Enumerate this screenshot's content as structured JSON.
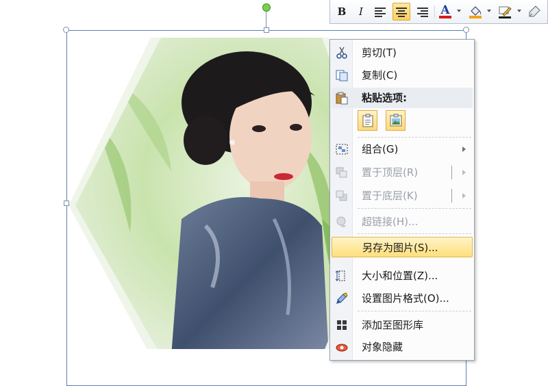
{
  "image": {
    "description_icon": "hexagon-portrait-photo",
    "colors": {
      "selection": "#5b7fb4",
      "rotate_handle": "#7bd04a",
      "bg_green": "#cfe7b3"
    }
  },
  "mini_toolbar": {
    "bold": "B",
    "italic": "I",
    "font_color": "A"
  },
  "context_menu": {
    "items": [
      {
        "label": "剪切(T)",
        "icon": "scissors-icon"
      },
      {
        "label": "复制(C)",
        "icon": "copy-icon"
      },
      {
        "label": "粘贴选项:",
        "icon": "paste-icon"
      },
      {
        "label": "组合(G)",
        "icon": "group-icon"
      },
      {
        "label": "置于顶层(R)",
        "icon": "bring-front-icon"
      },
      {
        "label": "置于底层(K)",
        "icon": "send-back-icon"
      },
      {
        "label": "超链接(H)...",
        "icon": "hyperlink-icon"
      },
      {
        "label": "另存为图片(S)...",
        "icon": "save-as-picture-icon"
      },
      {
        "label": "大小和位置(Z)...",
        "icon": "size-position-icon"
      },
      {
        "label": "设置图片格式(O)...",
        "icon": "format-picture-icon"
      },
      {
        "label": "添加至图形库",
        "icon": "add-to-gallery-icon"
      },
      {
        "label": "对象隐藏",
        "icon": "hide-object-icon"
      }
    ]
  }
}
